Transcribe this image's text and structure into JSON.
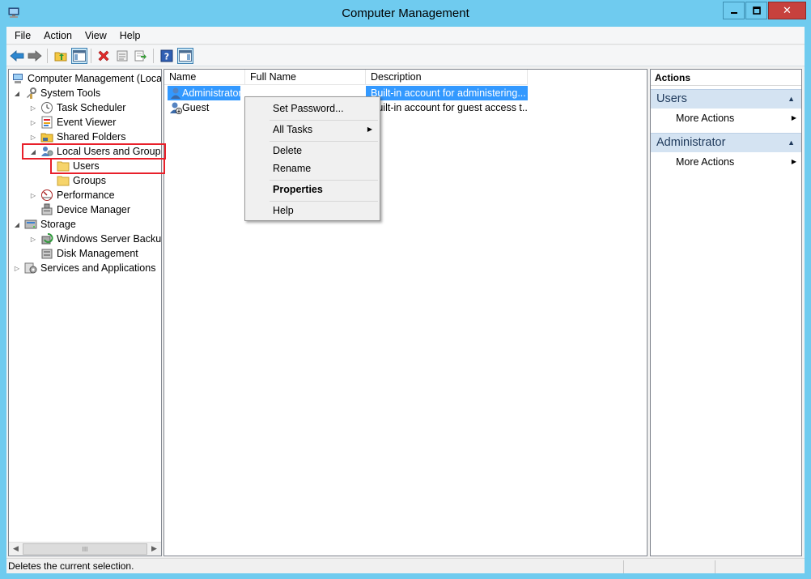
{
  "window": {
    "title": "Computer Management",
    "close_glyph": "✕"
  },
  "menu": [
    "File",
    "Action",
    "View",
    "Help"
  ],
  "toolbar": {
    "buttons": [
      "back-icon",
      "forward-icon",
      "up-folder-icon",
      "show-hide-tree-icon",
      "delete-icon",
      "properties-icon",
      "export-list-icon",
      "help-icon",
      "show-hide-action-pane-icon"
    ]
  },
  "tree": {
    "root": "Computer Management (Local",
    "system_tools": "System Tools",
    "task_scheduler": "Task Scheduler",
    "event_viewer": "Event Viewer",
    "shared_folders": "Shared Folders",
    "local_users_groups": "Local Users and Groups",
    "users": "Users",
    "groups": "Groups",
    "performance": "Performance",
    "device_manager": "Device Manager",
    "storage": "Storage",
    "windows_server_backup": "Windows Server Backup",
    "disk_management": "Disk Management",
    "services_applications": "Services and Applications",
    "scroll_thumb_glyph": "III"
  },
  "list": {
    "columns": [
      "Name",
      "Full Name",
      "Description"
    ],
    "rows": [
      {
        "name": "Administrator",
        "full_name": "",
        "description": "Built-in account for administering...",
        "selected": true
      },
      {
        "name": "Guest",
        "full_name": "",
        "description": "Built-in account for guest access t...",
        "selected": false
      }
    ]
  },
  "context_menu": {
    "items": [
      "Set Password...",
      "All Tasks",
      "Delete",
      "Rename",
      "Properties",
      "Help"
    ]
  },
  "actions": {
    "header": "Actions",
    "sections": [
      {
        "title": "Users",
        "item": "More Actions"
      },
      {
        "title": "Administrator",
        "item": "More Actions"
      }
    ]
  },
  "status": {
    "text": "Deletes the current selection."
  },
  "colors": {
    "title_bar": "#6fcbef",
    "close_button": "#c7413d",
    "selection": "#3399ff",
    "highlight_box": "#e8202a",
    "actions_section": "#d4e3f2"
  }
}
